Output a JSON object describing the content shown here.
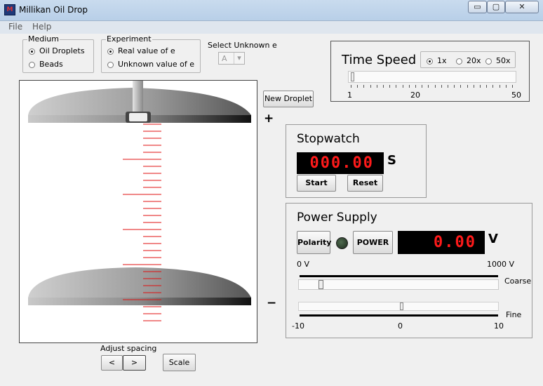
{
  "window": {
    "title": "Millikan Oil Drop",
    "icon_text": "M",
    "min_label": "▭",
    "max_label": "▢",
    "close_label": "✕"
  },
  "menu": {
    "file": "File",
    "help": "Help"
  },
  "medium": {
    "legend": "Medium",
    "options": [
      "Oil Droplets",
      "Beads"
    ],
    "selected": 0
  },
  "experiment": {
    "legend": "Experiment",
    "options": [
      "Real value of e",
      "Unknown value of e"
    ],
    "selected": 0
  },
  "unknown": {
    "label": "Select Unknown e",
    "value": "A",
    "arrow": "▾"
  },
  "time_speed": {
    "title": "Time Speed",
    "options": [
      "1x",
      "20x",
      "50x"
    ],
    "selected": 0,
    "ticks": [
      "1",
      "20",
      "50"
    ],
    "level": 1
  },
  "chamber": {
    "new_droplet": "New Droplet",
    "plus": "+",
    "minus": "−"
  },
  "stopwatch": {
    "title": "Stopwatch",
    "display": "000.00",
    "unit": "S",
    "start": "Start",
    "reset": "Reset"
  },
  "power": {
    "title": "Power Supply",
    "polarity": "Polarity",
    "power_button": "POWER",
    "display": "0.00",
    "unit": "V",
    "coarse_min": "0 V",
    "coarse_max": "1000 V",
    "coarse_label": "Coarse",
    "fine_label": "Fine",
    "fine_min": "-10",
    "fine_mid": "0",
    "fine_max": "10"
  },
  "spacing": {
    "label": "Adjust spacing",
    "left": "<",
    "right": ">",
    "scale": "Scale"
  }
}
